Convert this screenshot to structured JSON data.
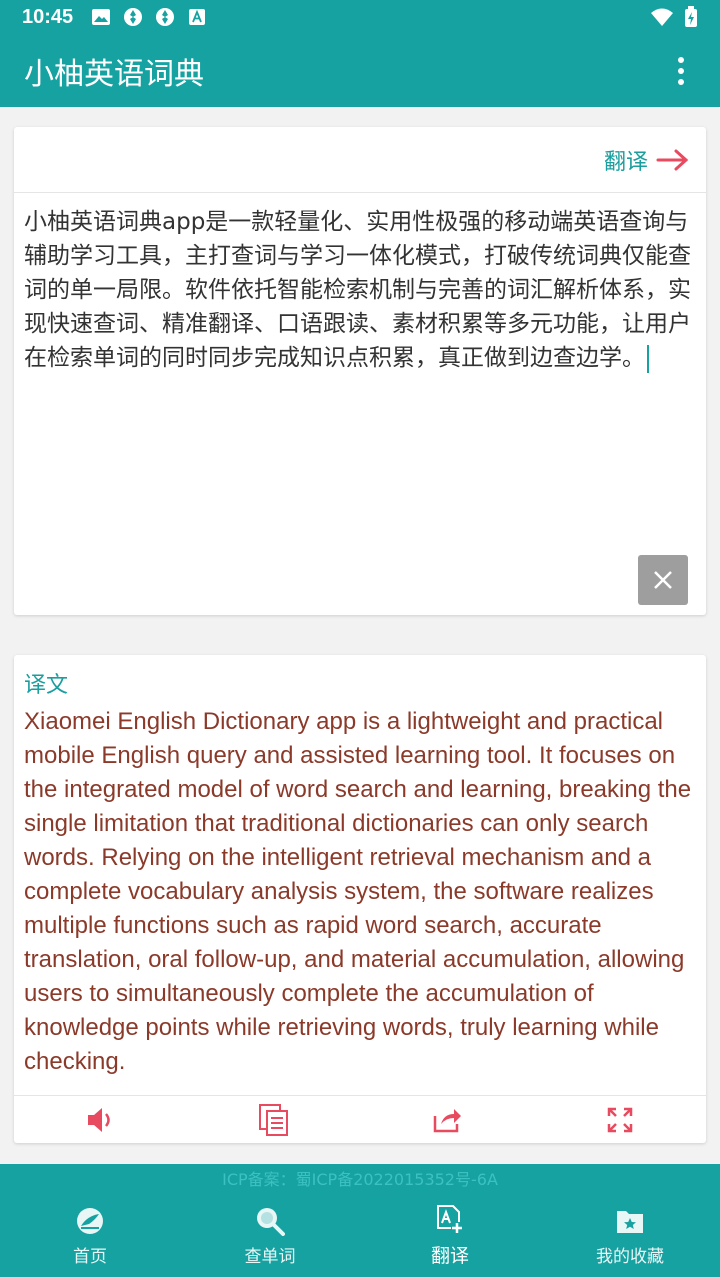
{
  "status_bar": {
    "time": "10:45"
  },
  "app_bar": {
    "title": "小柚英语词典"
  },
  "input_card": {
    "translate_label": "翻译",
    "source_text": "小柚英语词典app是一款轻量化、实用性极强的移动端英语查询与辅助学习工具，主打查词与学习一体化模式，打破传统词典仅能查词的单一局限。软件依托智能检索机制与完善的词汇解析体系，实现快速查词、精准翻译、口语跟读、素材积累等多元功能，让用户在检索单词的同时同步完成知识点积累，真正做到边查边学。"
  },
  "output_card": {
    "label": "译文",
    "translated_text": "Xiaomei English Dictionary app is a lightweight and practical mobile English query and assisted learning tool. It focuses on the integrated model of word search and learning, breaking the single limitation that traditional dictionaries can only search words. Relying on the intelligent retrieval mechanism and a complete vocabulary analysis system, the software realizes multiple functions such as rapid word search, accurate translation, oral follow-up, and material accumulation, allowing users to simultaneously complete the accumulation of knowledge points while retrieving words, truly learning while checking."
  },
  "footer": {
    "icp": "ICP备案：蜀ICP备2022015352号-6A"
  },
  "bottom_nav": [
    {
      "label": "首页",
      "icon": "home-icon"
    },
    {
      "label": "查单词",
      "icon": "search-icon"
    },
    {
      "label": "翻译",
      "icon": "translate-icon",
      "active": true
    },
    {
      "label": "我的收藏",
      "icon": "favorites-folder-icon"
    }
  ],
  "colors": {
    "primary": "#17a2a2",
    "accent": "#e84a5f",
    "translated_text": "#8b3a2a"
  }
}
